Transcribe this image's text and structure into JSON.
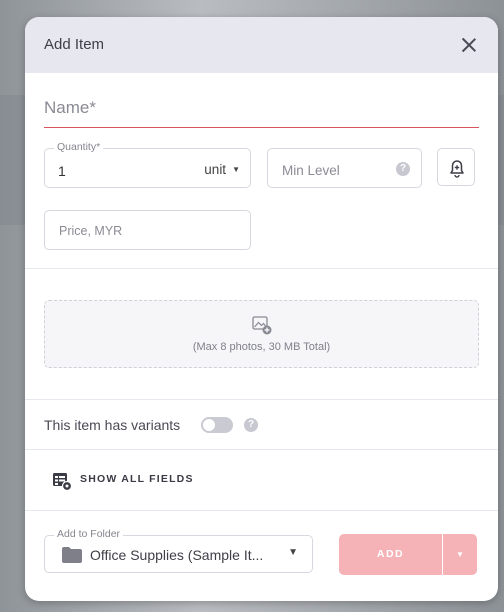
{
  "modal": {
    "title": "Add Item",
    "name_placeholder": "Name*"
  },
  "quantity": {
    "label": "Quantity*",
    "value": "1",
    "unit": "unit"
  },
  "min_level": {
    "placeholder": "Min Level",
    "help": "?"
  },
  "price": {
    "placeholder": "Price, MYR"
  },
  "photos": {
    "caption": "(Max 8 photos, 30 MB Total)"
  },
  "variants": {
    "label": "This item has variants",
    "enabled": false,
    "help": "?"
  },
  "show_fields": {
    "label": "SHOW ALL FIELDS"
  },
  "folder": {
    "label": "Add to Folder",
    "value": "Office Supplies (Sample It..."
  },
  "actions": {
    "add_label": "ADD"
  },
  "icons": {
    "close": "close-icon",
    "bell": "bell-plus-icon",
    "photo": "add-photo-icon",
    "fields": "form-fields-icon",
    "folder": "folder-icon",
    "caret": "chevron-down-icon"
  },
  "colors": {
    "accent": "#d9535d",
    "add_button_disabled": "#f5b2b7",
    "header_bg": "#e6e7ef"
  }
}
